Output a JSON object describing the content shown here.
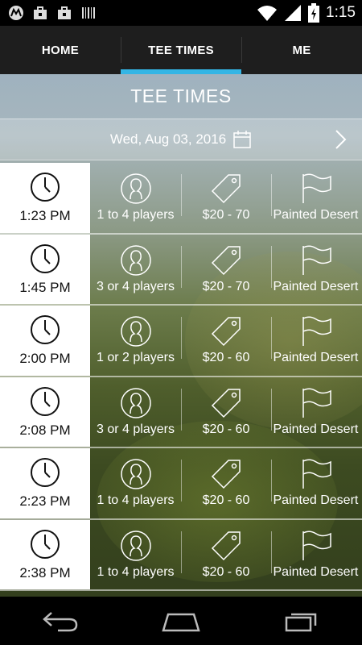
{
  "status_bar": {
    "time": "1:15",
    "left_icons": [
      "motorola-icon",
      "briefcase-icon",
      "briefcase-icon",
      "barcode-icon"
    ],
    "right_icons": [
      "wifi-icon",
      "signal-icon",
      "battery-charging-icon"
    ]
  },
  "tabs": [
    {
      "label": "HOME",
      "active": false
    },
    {
      "label": "TEE TIMES",
      "active": true
    },
    {
      "label": "ME",
      "active": false
    }
  ],
  "page": {
    "title": "TEE TIMES",
    "date": "Wed, Aug 03, 2016",
    "date_icon": "calendar-icon",
    "next_icon": "chevron-right-icon"
  },
  "tee_times": [
    {
      "time": "1:23 PM",
      "players": "1 to 4 players",
      "price": "$20 - 70",
      "course": "Painted Desert"
    },
    {
      "time": "1:45 PM",
      "players": "3 or 4 players",
      "price": "$20 - 70",
      "course": "Painted Desert"
    },
    {
      "time": "2:00 PM",
      "players": "1 or 2 players",
      "price": "$20 - 60",
      "course": "Painted Desert"
    },
    {
      "time": "2:08 PM",
      "players": "3 or 4 players",
      "price": "$20 - 60",
      "course": "Painted Desert"
    },
    {
      "time": "2:23 PM",
      "players": "1 to 4 players",
      "price": "$20 - 60",
      "course": "Painted Desert"
    },
    {
      "time": "2:38 PM",
      "players": "1 to 4 players",
      "price": "$20 - 60",
      "course": "Painted Desert"
    }
  ],
  "nav_bar": [
    "back-icon",
    "home-icon",
    "recents-icon"
  ],
  "colors": {
    "accent": "#33b5e5",
    "tab_bg": "#1e1e1e"
  }
}
